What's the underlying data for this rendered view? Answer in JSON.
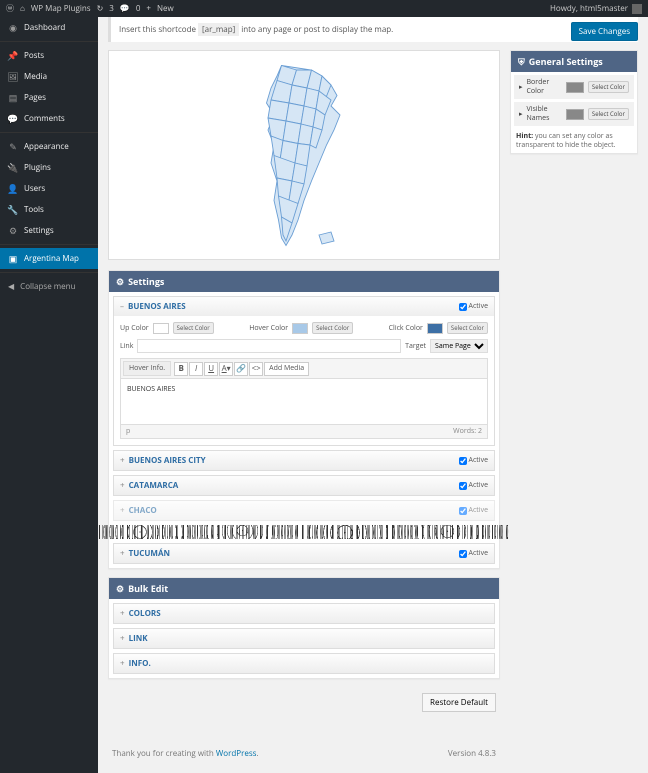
{
  "adminbar": {
    "site": "WP Map Plugins",
    "comments": "0",
    "updates": "3",
    "new": "New",
    "howdy": "Howdy, html5master"
  },
  "menu": {
    "dashboard": "Dashboard",
    "posts": "Posts",
    "media": "Media",
    "pages": "Pages",
    "comments": "Comments",
    "appearance": "Appearance",
    "plugins": "Plugins",
    "users": "Users",
    "tools": "Tools",
    "settings": "Settings",
    "argentina": "Argentina Map",
    "collapse": "Collapse menu"
  },
  "notice": {
    "prefix": "Insert this shortcode",
    "code": "[ar_map]",
    "suffix": "into any page or post to display the map."
  },
  "save_button": "Save Changes",
  "general": {
    "title": "General Settings",
    "border_label": "Border Color",
    "names_label": "Visible Names",
    "select": "Select Color",
    "border_color": "#808080",
    "names_color": "#808080",
    "hint_label": "Hint:",
    "hint_text": "you can set any color as transparent to hide the object."
  },
  "settings": {
    "title": "Settings",
    "active_label": "Active",
    "up_label": "Up Color",
    "hover_label": "Hover Color",
    "click_label": "Click Color",
    "link_label": "Link",
    "target_label": "Target",
    "target_value": "Same Page",
    "select": "Select Color",
    "up_color": "#ffffff",
    "hover_color": "#a8c9e8",
    "click_color": "#3d6fa5",
    "hover_info_tab": "Hover Info.",
    "add_media": "Add Media",
    "editor_content": "BUENOS AIRES",
    "editor_path": "p",
    "words_label": "Words:",
    "words": "2",
    "regions": {
      "r0": "BUENOS AIRES",
      "r1": "BUENOS AIRES CITY",
      "r2": "CATAMARCA",
      "r3": "CHACO",
      "r4": "TUCUMÁN"
    }
  },
  "bulk": {
    "title": "Bulk Edit",
    "colors": "COLORS",
    "link": "LINK",
    "info": "INFO."
  },
  "restore": "Restore Default",
  "footer": {
    "thank": "Thank you for creating with ",
    "wp": "WordPress",
    "version": "Version 4.8.3"
  }
}
